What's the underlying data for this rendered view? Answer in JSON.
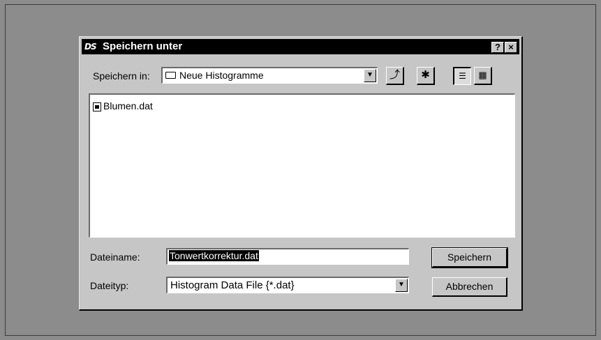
{
  "dialog": {
    "title": "Speichern unter",
    "help_label": "?",
    "close_label": "×"
  },
  "save_in": {
    "label": "Speichern in:",
    "folder": "Neue Histogramme",
    "dropdown_arrow": "▼"
  },
  "toolbar": {
    "up_icon": "folder-up-icon",
    "new_folder_icon": "new-folder-icon",
    "list_view_icon": "list-view-icon",
    "details_view_icon": "details-view-icon"
  },
  "files": [
    {
      "name": "Blumen.dat",
      "icon": "data-file-icon"
    }
  ],
  "filename": {
    "label": "Dateiname:",
    "value": "Tonwertkorrektur.dat"
  },
  "filetype": {
    "label": "Dateityp:",
    "value": "Histogram Data File {*.dat}",
    "dropdown_arrow": "▼"
  },
  "buttons": {
    "save": "Speichern",
    "cancel": "Abbrechen"
  }
}
